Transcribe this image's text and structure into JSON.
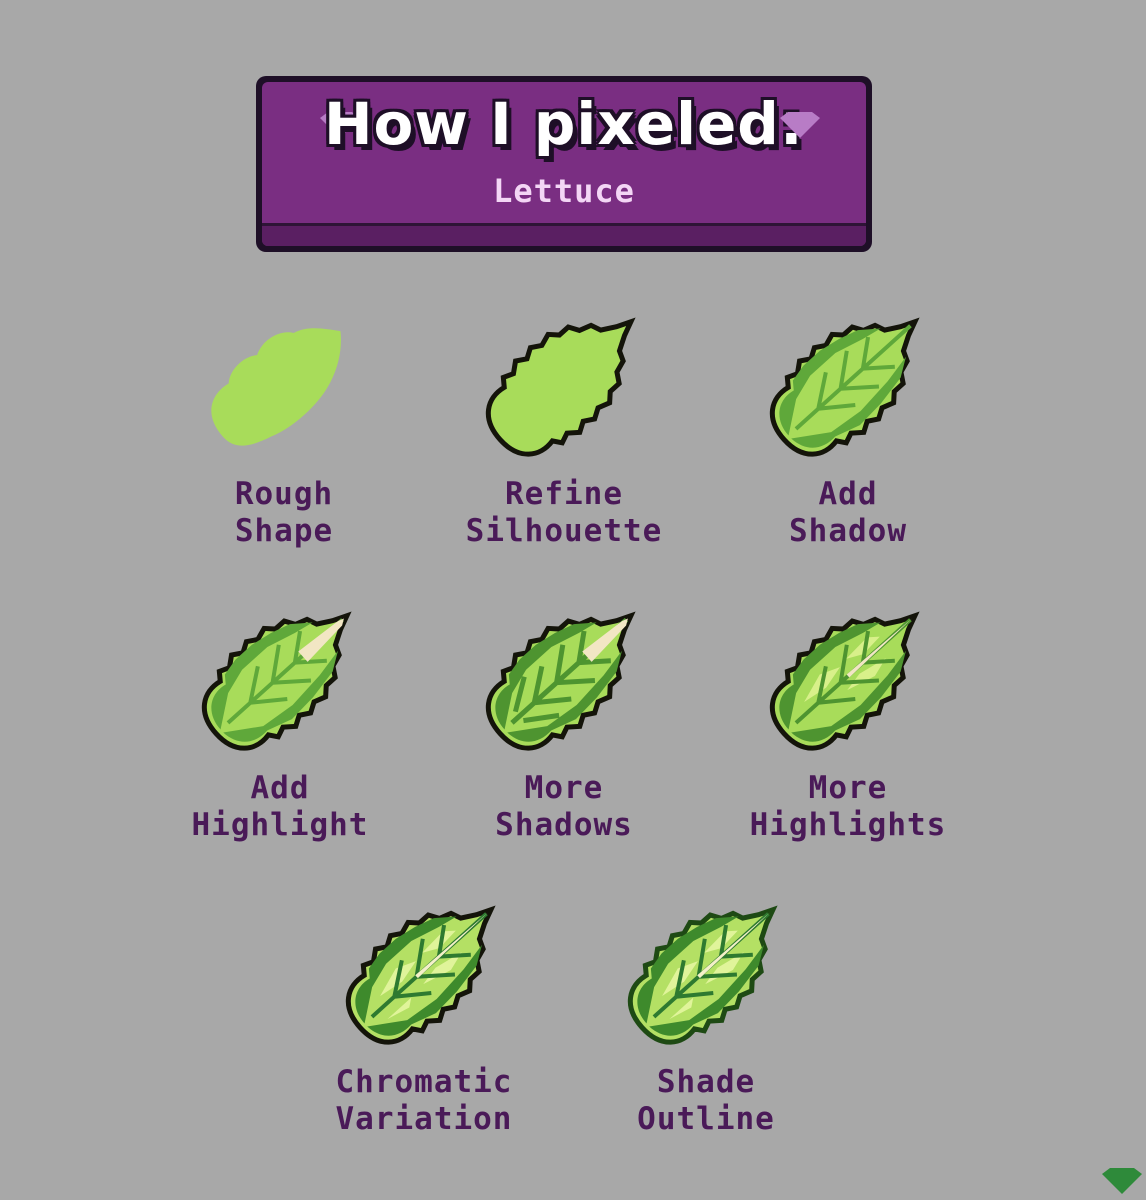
{
  "banner": {
    "title": "How I pixeled:",
    "subtitle": "Lettuce"
  },
  "steps": [
    {
      "line1": "Rough",
      "line2": "Shape"
    },
    {
      "line1": "Refine",
      "line2": "Silhouette"
    },
    {
      "line1": "Add",
      "line2": "Shadow"
    },
    {
      "line1": "Add",
      "line2": "Highlight"
    },
    {
      "line1": "More",
      "line2": "Shadows"
    },
    {
      "line1": "More",
      "line2": "Highlights"
    },
    {
      "line1": "Chromatic",
      "line2": "Variation"
    },
    {
      "line1": "Shade",
      "line2": "Outline"
    }
  ],
  "colors": {
    "background": "#a8a8a8",
    "banner_fill": "#7a2e82",
    "banner_outline": "#1e0f27",
    "label_text": "#4a1a58",
    "leaf_base": "#a8dc5a",
    "leaf_shadow": "#5fa83a",
    "leaf_highlight": "#d8f08a",
    "leaf_cream": "#f2e6c4",
    "leaf_outline": "#14140a"
  },
  "icons": [
    "gem-icon",
    "lettuce-leaf-icon",
    "corner-badge-icon"
  ]
}
